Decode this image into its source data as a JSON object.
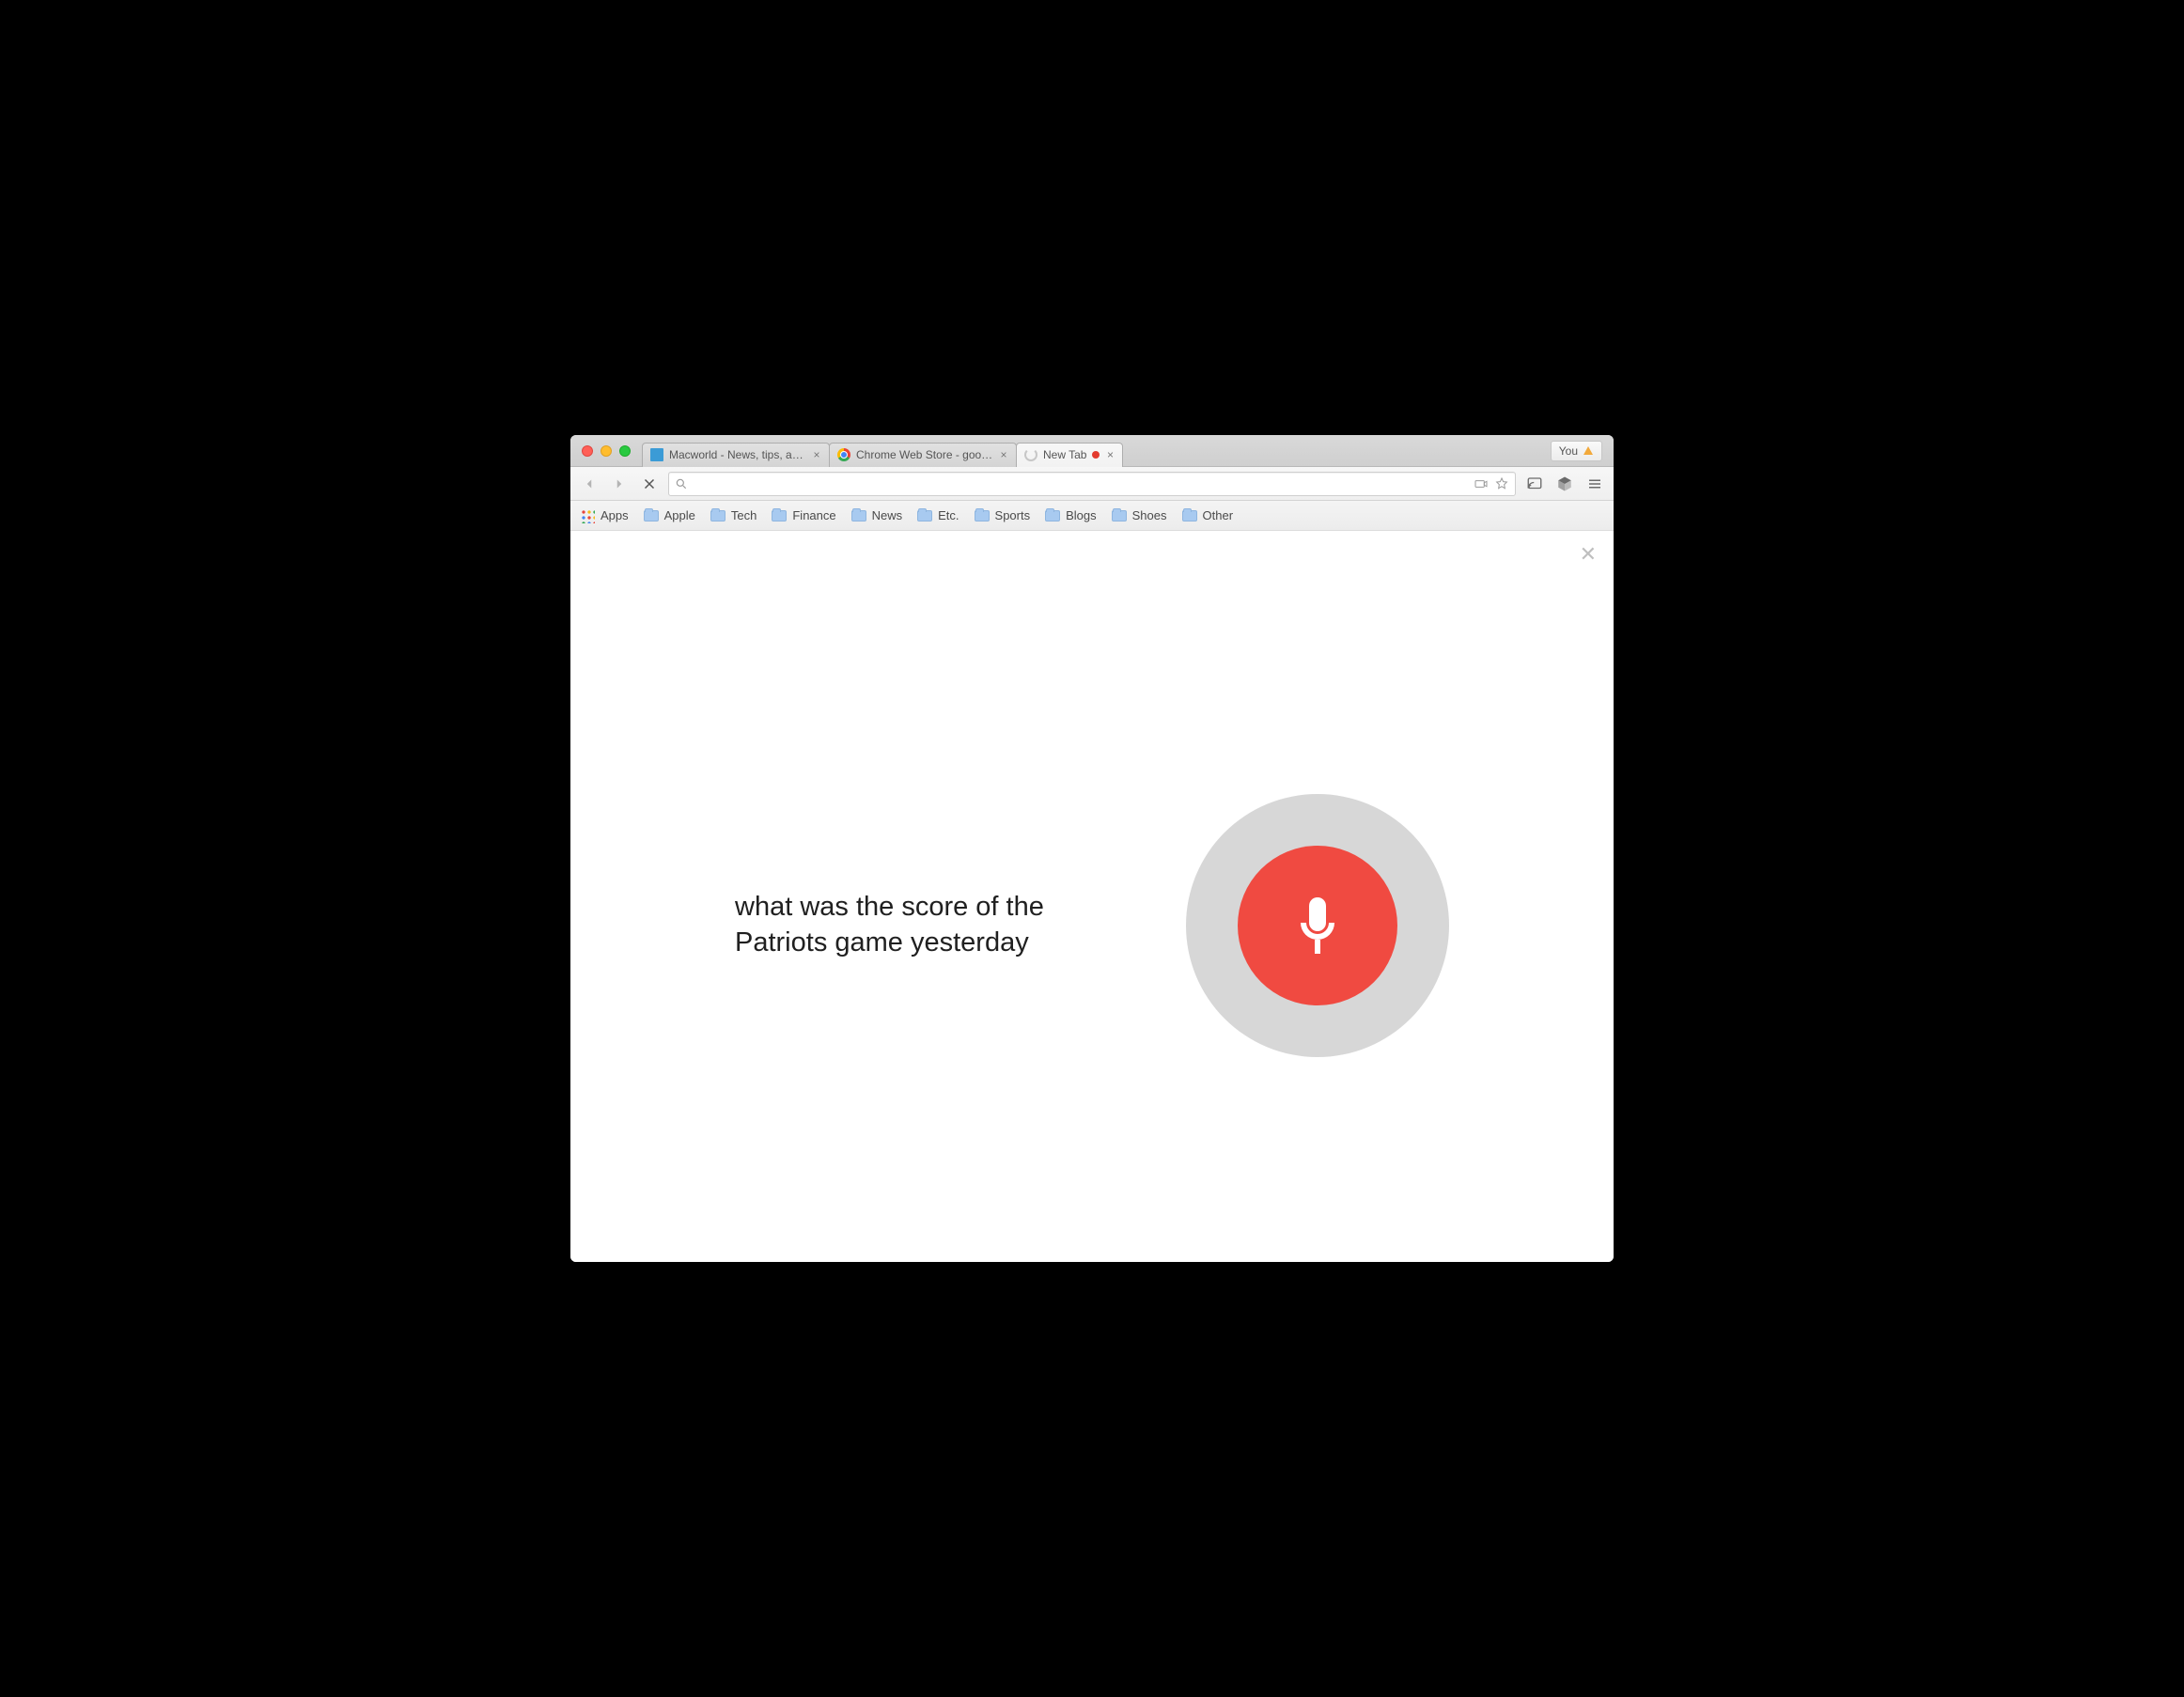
{
  "tabs": [
    {
      "title": "Macworld - News, tips, and …"
    },
    {
      "title": "Chrome Web Store - googl…"
    },
    {
      "title": "New Tab",
      "active": true,
      "recording": true
    }
  ],
  "user_chip": {
    "label": "You"
  },
  "bookmarks": {
    "apps_label": "Apps",
    "folders": [
      "Apple",
      "Tech",
      "Finance",
      "News",
      "Etc.",
      "Sports",
      "Blogs",
      "Shoes",
      "Other"
    ]
  },
  "omnibox": {
    "value": "",
    "placeholder": ""
  },
  "voice": {
    "query": "what was the score of the Patriots game yesterday",
    "mic_color": "#f04a41",
    "ring_color": "#d7d7d7"
  }
}
